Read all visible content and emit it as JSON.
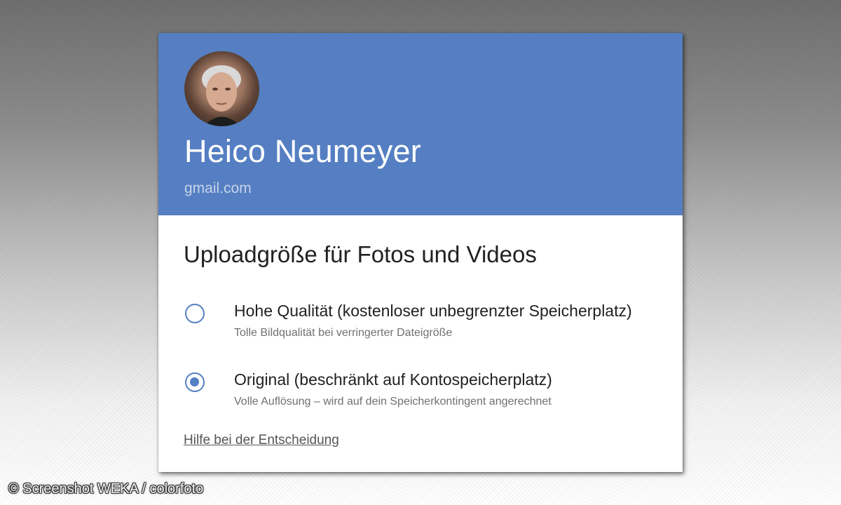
{
  "account": {
    "name": "Heico Neumeyer",
    "email": "gmail.com",
    "avatar_alt": "profile photo"
  },
  "dialog": {
    "title": "Uploadgröße für Fotos und Videos",
    "options": [
      {
        "label": "Hohe Qualität (kostenloser unbegrenzter Speicherplatz)",
        "description": "Tolle Bildqualität bei verringerter Dateigröße",
        "selected": false
      },
      {
        "label": "Original (beschränkt auf Kontospeicherplatz)",
        "description": "Volle Auflösung – wird auf dein Speicherkontingent angerechnet",
        "selected": true
      }
    ],
    "help_link": "Hilfe bei der Entscheidung"
  },
  "credit": "© Screenshot WEKA / colorfoto",
  "colors": {
    "header": "#557fc2",
    "radio": "#557fc2"
  }
}
